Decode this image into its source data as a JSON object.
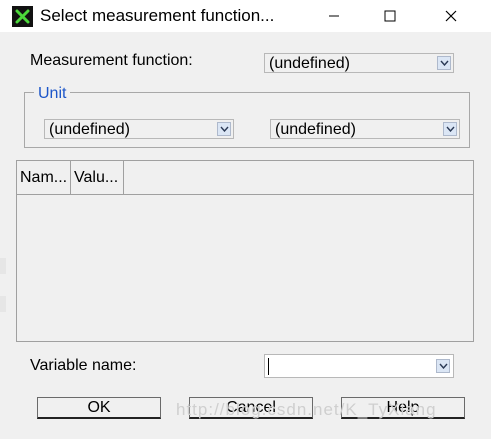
{
  "window": {
    "title": "Select measurement function...",
    "minimize_label": "—",
    "maximize_label": "☐",
    "close_label": "✕"
  },
  "measurement": {
    "label": "Measurement function:",
    "value": "(undefined)"
  },
  "unit": {
    "group_label": "Unit",
    "left_value": "(undefined)",
    "right_value": "(undefined)"
  },
  "list": {
    "columns": [
      "Nam...",
      "Valu..."
    ]
  },
  "variable": {
    "label": "Variable name:",
    "value": ""
  },
  "buttons": {
    "ok": "OK",
    "cancel": "Cancel",
    "help": "Help"
  },
  "watermark": "http://blog.csdn.net/K_TyXiang",
  "colors": {
    "group_title": "#1c56c9",
    "dialog_bg": "#f0f0f0"
  }
}
